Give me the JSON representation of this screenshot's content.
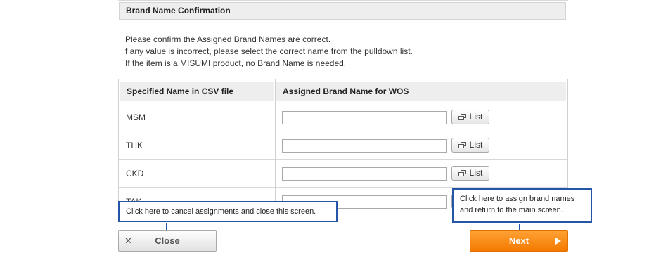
{
  "section": {
    "title": "Brand Name Confirmation"
  },
  "instructions": [
    "Please confirm the Assigned Brand Names are correct.",
    "f any value is incorrect, please select the correct name from the pulldown list.",
    "If the item is a MISUMI product, no Brand Name is needed."
  ],
  "table": {
    "headers": {
      "specified": "Specified Name in CSV file",
      "assigned": "Assigned Brand Name for WOS"
    },
    "list_label": "List",
    "rows": [
      {
        "specified": "MSM",
        "assigned": ""
      },
      {
        "specified": "THK",
        "assigned": ""
      },
      {
        "specified": "CKD",
        "assigned": ""
      },
      {
        "specified": "TAK",
        "assigned": ""
      }
    ]
  },
  "callouts": {
    "close": "Click here to cancel assignments and close this screen.",
    "next_line1": "Click here to assign brand names",
    "next_line2": "and return to the main screen."
  },
  "buttons": {
    "close": "Close",
    "next": "Next"
  },
  "icons": {
    "close": "close-x-icon",
    "next": "play-arrow-icon",
    "list": "window-icon"
  },
  "colors": {
    "callout_border": "#2555a6",
    "next_button": "#f47a00"
  }
}
